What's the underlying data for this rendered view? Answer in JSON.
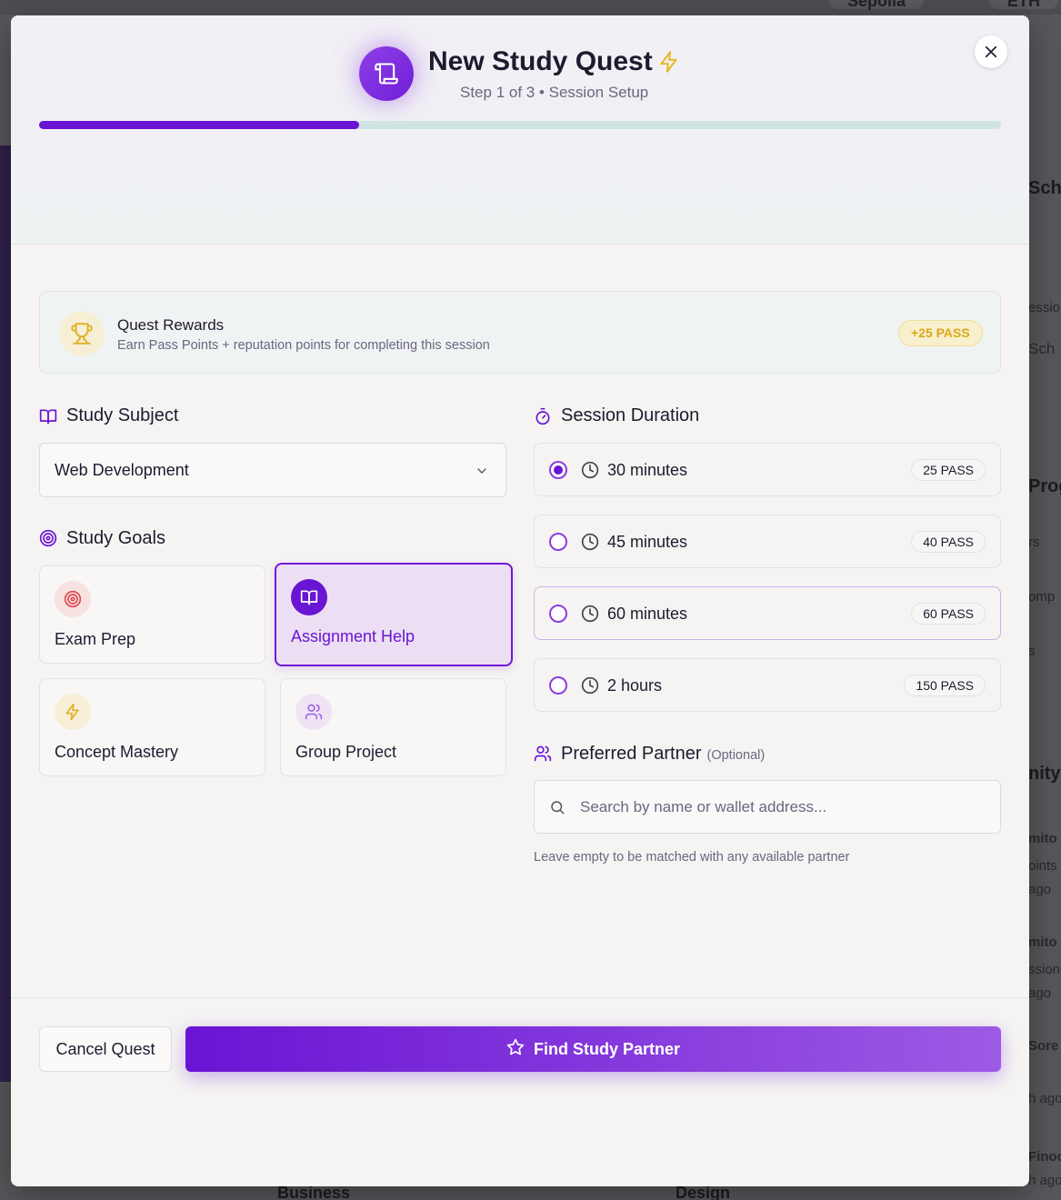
{
  "background": {
    "top_pills": [
      "Sepolia",
      "ETH"
    ],
    "right_fragments": [
      "Sche",
      "essio",
      "Sch",
      "Prog",
      "rs",
      "omp",
      "s",
      "nity",
      "mito",
      "oints",
      "ago",
      "mito",
      "ssion",
      "ago",
      "Sore",
      "h ago",
      "Finoc",
      "h ago"
    ],
    "bottom_fragments": [
      "Business",
      "Design"
    ]
  },
  "modal": {
    "title": "New Study Quest",
    "subtitle": "Step 1 of 3 • Session Setup",
    "progress_fraction": 0.333
  },
  "rewards": {
    "title": "Quest Rewards",
    "description": "Earn Pass Points + reputation points for completing this session",
    "badge": "+25 PASS"
  },
  "subject": {
    "label": "Study Subject",
    "selected_value": "Web Development"
  },
  "goals": {
    "label": "Study Goals",
    "items": [
      {
        "label": "Exam Prep",
        "icon": "target-icon",
        "selected": false
      },
      {
        "label": "Assignment Help",
        "icon": "book-icon",
        "selected": true
      },
      {
        "label": "Concept Mastery",
        "icon": "bolt-icon",
        "selected": false
      },
      {
        "label": "Group Project",
        "icon": "users-icon",
        "selected": false
      }
    ]
  },
  "duration": {
    "label": "Session Duration",
    "options": [
      {
        "label": "30 minutes",
        "pass": "25 PASS",
        "selected": true
      },
      {
        "label": "45 minutes",
        "pass": "40 PASS",
        "selected": false
      },
      {
        "label": "60 minutes",
        "pass": "60 PASS",
        "selected": false
      },
      {
        "label": "2 hours",
        "pass": "150 PASS",
        "selected": false
      }
    ]
  },
  "partner": {
    "label": "Preferred Partner",
    "optional": "(Optional)",
    "placeholder": "Search by name or wallet address...",
    "hint": "Leave empty to be matched with any available partner"
  },
  "footer": {
    "cancel_label": "Cancel Quest",
    "find_label": "Find Study Partner"
  },
  "colors": {
    "accent": "#6a14d4",
    "reward_gold": "#d9a91c"
  }
}
